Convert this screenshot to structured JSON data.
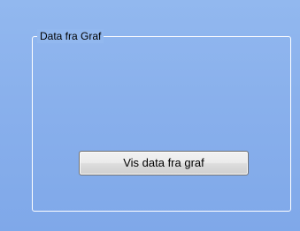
{
  "group": {
    "title": "Data fra Graf"
  },
  "button": {
    "label": "Vis data fra graf"
  },
  "colors": {
    "background": "#89b0ec",
    "group_border": "#ffffff",
    "button_border": "#707070"
  }
}
